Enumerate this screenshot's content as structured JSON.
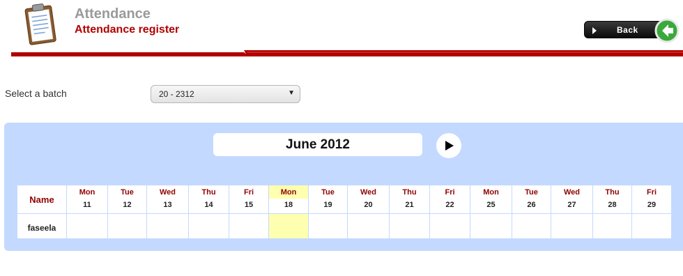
{
  "header": {
    "title": "Attendance",
    "subtitle": "Attendance register",
    "back_label": "Back",
    "icon": "clipboard-icon",
    "accent_color": "#b20000"
  },
  "batch": {
    "label": "Select a batch",
    "selected": "20 - 2312"
  },
  "calendar": {
    "month_title": "June 2012",
    "name_header": "Name",
    "days": [
      {
        "dow": "Mon",
        "date": "11"
      },
      {
        "dow": "Tue",
        "date": "12"
      },
      {
        "dow": "Wed",
        "date": "13"
      },
      {
        "dow": "Thu",
        "date": "14"
      },
      {
        "dow": "Fri",
        "date": "15"
      },
      {
        "dow": "Mon",
        "date": "18"
      },
      {
        "dow": "Tue",
        "date": "19"
      },
      {
        "dow": "Wed",
        "date": "20"
      },
      {
        "dow": "Thu",
        "date": "21"
      },
      {
        "dow": "Fri",
        "date": "22"
      },
      {
        "dow": "Mon",
        "date": "25"
      },
      {
        "dow": "Tue",
        "date": "26"
      },
      {
        "dow": "Wed",
        "date": "27"
      },
      {
        "dow": "Thu",
        "date": "28"
      },
      {
        "dow": "Fri",
        "date": "29"
      }
    ],
    "highlight_date": "18",
    "highlight_color": "#ffffb0",
    "students": [
      {
        "name": "faseela"
      }
    ]
  }
}
